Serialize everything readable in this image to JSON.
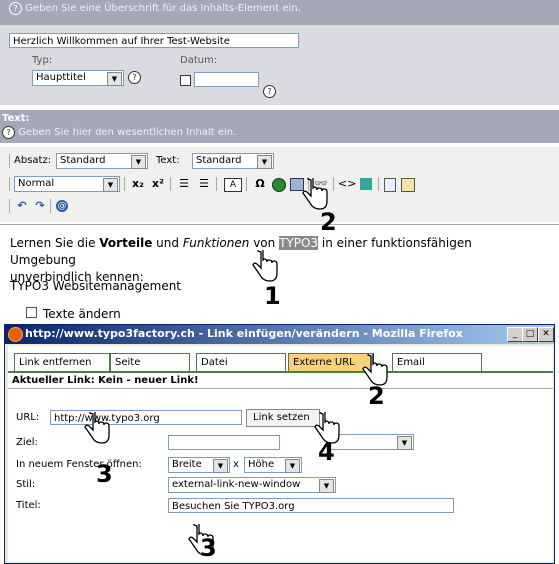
{
  "header": {
    "help_text": "Geben Sie eine Überschrift für das Inhalts-Element ein."
  },
  "headline": {
    "value": "Herzlich Willkommen auf Ihrer Test-Website",
    "type_label": "Typ:",
    "type_value": "Haupttitel",
    "date_label": "Datum:"
  },
  "text_section": {
    "title": "Text:",
    "help_text": "Geben Sie hier den wesentlichen Inhalt ein."
  },
  "toolbar": {
    "absatz_label": "Absatz:",
    "absatz_value": "Standard",
    "text_label": "Text:",
    "text_value": "Standard",
    "block_value": "Normal",
    "sub": "x₂",
    "sup": "x²",
    "omega": "Ω",
    "a_btn": "A",
    "binoculars": "⚲"
  },
  "editor": {
    "p1_pre": "Lernen Sie die ",
    "p1_bold": "Vorteile",
    "p1_mid": " und ",
    "p1_italic": "Funktionen",
    "p1_von": " von ",
    "p1_sel": "TYPO3",
    "p1_post": " in einer funktionsfähigen Umgebung",
    "p1_line2": "unverbindlich kennen:",
    "p2": "TYPO3 Websitemanagement",
    "p3": "Texte ändern"
  },
  "dialog": {
    "title": "http://www.typo3factory.ch - Link einfügen/verändern - Mozilla Firefox",
    "tabs": [
      "Link entfernen",
      "Seite",
      "Datei",
      "Externe URL",
      "Email"
    ],
    "current_link": "Aktueller Link: Kein - neuer Link!",
    "url_label": "URL:",
    "url_value": "http://www.typo3.org",
    "set_link_button": "Link setzen",
    "target_label": "Ziel:",
    "new_window_label": "In neuem Fenster öffnen:",
    "width_value": "Breite",
    "x_sep": "x",
    "height_value": "Höhe",
    "style_label": "Stil:",
    "style_value": "external-link-new-window",
    "title_label": "Titel:",
    "title_value": "Besuchen Sie TYPO3.org"
  },
  "callouts": [
    "1",
    "2",
    "2",
    "3",
    "4",
    "3"
  ],
  "colors": {
    "band": "#a6a8b8",
    "selected_tab": "#f6d37a",
    "titlebar": "#0a246a",
    "tab_border": "#4c7a4c"
  }
}
